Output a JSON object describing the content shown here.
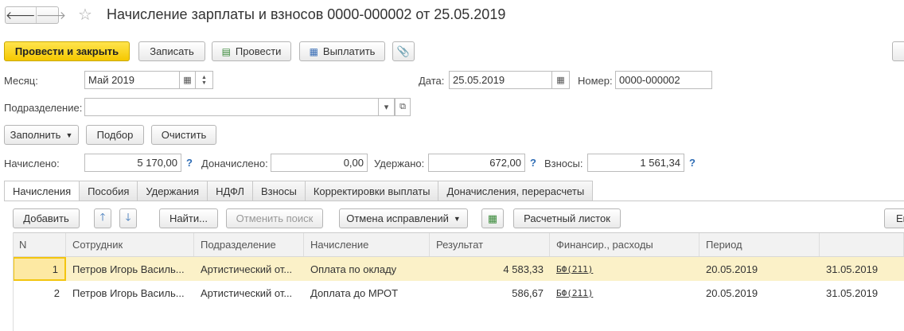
{
  "header": {
    "back_glyph": "🡐",
    "forward_glyph": "🡒",
    "title": "Начисление зарплаты и взносов 0000-000002 от 25.05.2019"
  },
  "toolbar": {
    "post_close_label": "Провести и закрыть",
    "save_label": "Записать",
    "post_label": "Провести",
    "pay_label": "Выплатить"
  },
  "form": {
    "month_label": "Месяц:",
    "month_value": "Май 2019",
    "date_label": "Дата:",
    "date_value": "25.05.2019",
    "number_label": "Номер:",
    "number_value": "0000-000002",
    "division_label": "Подразделение:",
    "division_value": "",
    "fill_label": "Заполнить",
    "select_label": "Подбор",
    "clear_label": "Очистить",
    "accrued_label": "Начислено:",
    "accrued_value": "5 170,00",
    "extra_label": "Доначислено:",
    "extra_value": "0,00",
    "withheld_label": "Удержано:",
    "withheld_value": "672,00",
    "contrib_label": "Взносы:",
    "contrib_value": "1 561,34",
    "help_glyph": "?"
  },
  "tabs": [
    {
      "label": "Начисления"
    },
    {
      "label": "Пособия"
    },
    {
      "label": "Удержания"
    },
    {
      "label": "НДФЛ"
    },
    {
      "label": "Взносы"
    },
    {
      "label": "Корректировки выплаты"
    },
    {
      "label": "Доначисления, перерасчеты"
    }
  ],
  "table_toolbar": {
    "add_label": "Добавить",
    "find_label": "Найти...",
    "cancel_search_label": "Отменить поиск",
    "cancel_fix_label": "Отмена исправлений",
    "payslip_label": "Расчетный листок",
    "more_label": "Ещ"
  },
  "table": {
    "columns": [
      "N",
      "Сотрудник",
      "Подразделение",
      "Начисление",
      "Результат",
      "Финансир., расходы",
      "Период",
      ""
    ],
    "rows": [
      {
        "n": "1",
        "employee": "Петров Игорь Василь...",
        "division": "Артистический от...",
        "accrual": "Оплата по окладу",
        "result": "4 583,33",
        "finance": "БФ(211)",
        "period_from": "20.05.2019",
        "period_to": "31.05.2019"
      },
      {
        "n": "2",
        "employee": "Петров Игорь Василь...",
        "division": "Артистический от...",
        "accrual": "Доплата до МРОТ",
        "result": "586,67",
        "finance": "БФ(211)",
        "period_from": "20.05.2019",
        "period_to": "31.05.2019"
      }
    ]
  }
}
